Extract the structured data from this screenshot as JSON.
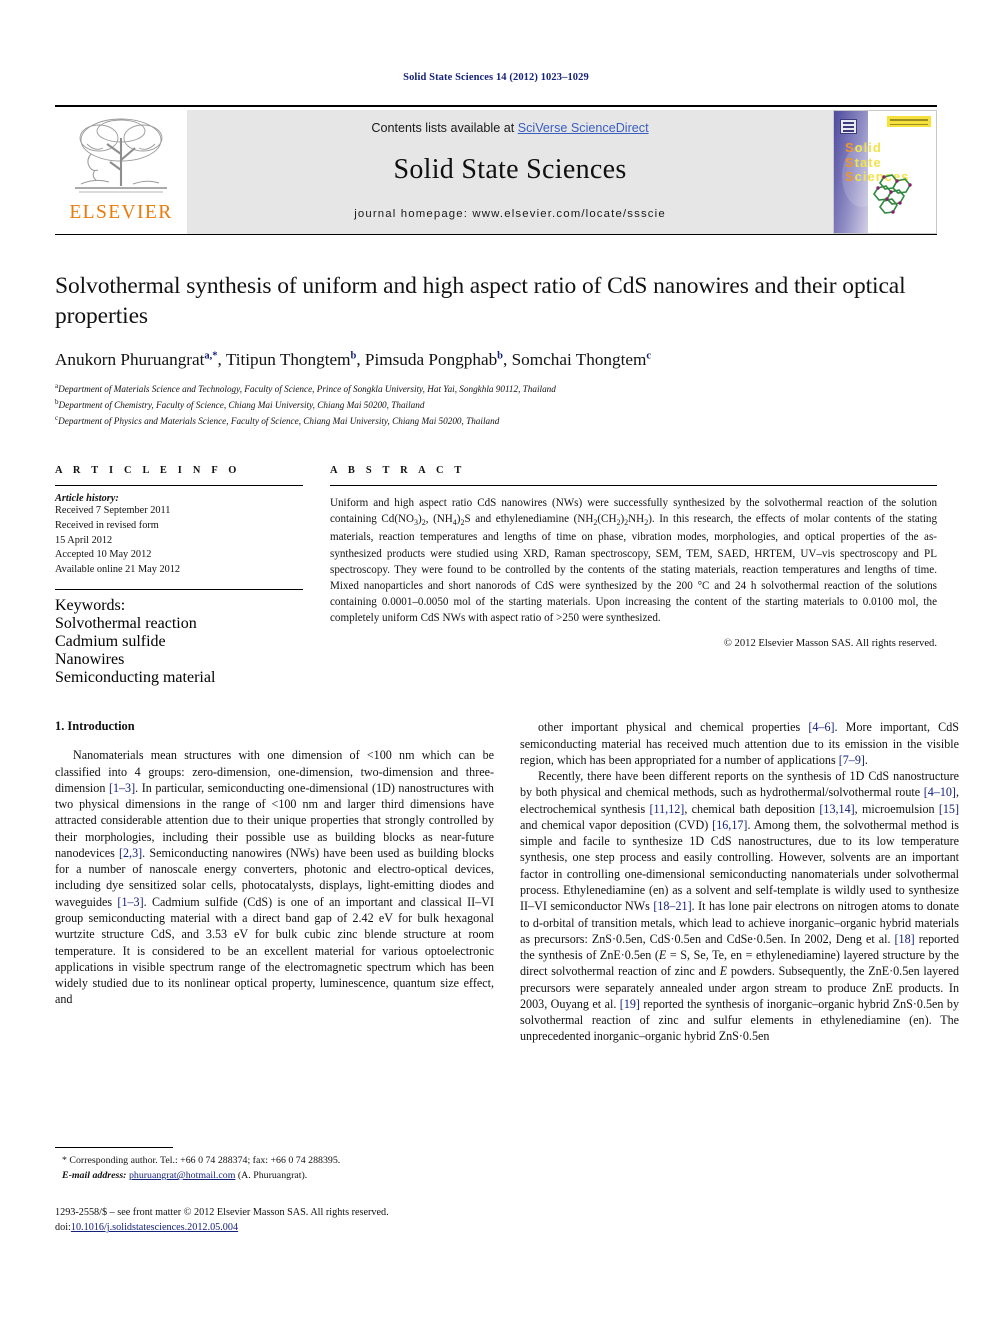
{
  "running_head": "Solid State Sciences 14 (2012) 1023–1029",
  "masthead": {
    "publisher_name": "ELSEVIER",
    "contents_prefix": "Contents lists available at ",
    "contents_link": "SciVerse ScienceDirect",
    "journal_name": "Solid State Sciences",
    "homepage": "journal homepage: www.elsevier.com/locate/ssscie",
    "cover": {
      "line1_first": "S",
      "line1_rest": "olid",
      "line2_first": "S",
      "line2_rest": "tate",
      "line3_first": "S",
      "line3_rest": "ciences"
    }
  },
  "title": "Solvothermal synthesis of uniform and high aspect ratio of CdS nanowires and their optical properties",
  "authors_html": "Anukorn Phuruangrat<sup>a,*</sup>, Titipun Thongtem<sup>b</sup>, Pimsuda Pongphab<sup>b</sup>, Somchai Thongtem<sup>c</sup>",
  "affiliations": [
    {
      "mark": "a",
      "text": "Department of Materials Science and Technology, Faculty of Science, Prince of Songkla University, Hat Yai, Songkhla 90112, Thailand"
    },
    {
      "mark": "b",
      "text": "Department of Chemistry, Faculty of Science, Chiang Mai University, Chiang Mai 50200, Thailand"
    },
    {
      "mark": "c",
      "text": "Department of Physics and Materials Science, Faculty of Science, Chiang Mai University, Chiang Mai 50200, Thailand"
    }
  ],
  "article_info": {
    "heading": "A R T I C L E   I N F O",
    "history_label": "Article history:",
    "history_lines": [
      "Received 7 September 2011",
      "Received in revised form",
      "15 April 2012",
      "Accepted 10 May 2012",
      "Available online 21 May 2012"
    ],
    "keywords_label": "Keywords:",
    "keywords": [
      "Solvothermal reaction",
      "Cadmium sulfide",
      "Nanowires",
      "Semiconducting material"
    ]
  },
  "abstract": {
    "heading": "A B S T R A C T",
    "text_html": "Uniform and high aspect ratio CdS nanowires (NWs) were successfully synthesized by the solvothermal reaction of the solution containing Cd(NO<sub>3</sub>)<sub>2</sub>, (NH<sub>4</sub>)<sub>2</sub>S and ethylenediamine (NH<sub>2</sub>(CH<sub>2</sub>)<sub>2</sub>NH<sub>2</sub>). In this research, the effects of molar contents of the stating materials, reaction temperatures and lengths of time on phase, vibration modes, morphologies, and optical properties of the as-synthesized products were studied using XRD, Raman spectroscopy, SEM, TEM, SAED, HRTEM, UV–vis spectroscopy and PL spectroscopy. They were found to be controlled by the contents of the stating materials, reaction temperatures and lengths of time. Mixed nanoparticles and short nanorods of CdS were synthesized by the 200 °C and 24 h solvothermal reaction of the solutions containing 0.0001–0.0050 mol of the starting materials. Upon increasing the content of the starting materials to 0.0100 mol, the completely uniform CdS NWs with aspect ratio of >250 were synthesized.",
    "copyright": "© 2012 Elsevier Masson SAS. All rights reserved."
  },
  "body": {
    "section_title": "1. Introduction",
    "left_paragraphs_html": [
      "Nanomaterials mean structures with one dimension of &lt;100 nm which can be classified into 4 groups: zero-dimension, one-dimension, two-dimension and three-dimension <span class=\"ref\">[1–3]</span>. In particular, semiconducting one-dimensional (1D) nanostructures with two physical dimensions in the range of &lt;100 nm and larger third dimensions have attracted considerable attention due to their unique properties that strongly controlled by their morphologies, including their possible use as building blocks as near-future nanodevices <span class=\"ref\">[2,3]</span>. Semiconducting nanowires (NWs) have been used as building blocks for a number of nanoscale energy converters, photonic and electro-optical devices, including dye sensitized solar cells, photocatalysts, displays, light-emitting diodes and waveguides <span class=\"ref\">[1–3]</span>. Cadmium sulfide (CdS) is one of an important and classical II–VI group semiconducting material with a direct band gap of 2.42 eV for bulk hexagonal wurtzite structure CdS, and 3.53 eV for bulk cubic zinc blende structure at room temperature. It is considered to be an excellent material for various optoelectronic applications in visible spectrum range of the electromagnetic spectrum which has been widely studied due to its nonlinear optical property, luminescence, quantum size effect, and"
    ],
    "right_paragraphs_html": [
      "other important physical and chemical properties <span class=\"ref\">[4–6]</span>. More important, CdS semiconducting material has received much attention due to its emission in the visible region, which has been appropriated for a number of applications <span class=\"ref\">[7–9]</span>.",
      "Recently, there have been different reports on the synthesis of 1D CdS nanostructure by both physical and chemical methods, such as hydrothermal/solvothermal route <span class=\"ref\">[4–10]</span>, electrochemical synthesis <span class=\"ref\">[11,12]</span>, chemical bath deposition <span class=\"ref\">[13,14]</span>, microemulsion <span class=\"ref\">[15]</span> and chemical vapor deposition (CVD) <span class=\"ref\">[16,17]</span>. Among them, the solvothermal method is simple and facile to synthesize 1D CdS nanostructures, due to its low temperature synthesis, one step process and easily controlling. However, solvents are an important factor in controlling one-dimensional semiconducting nanomaterials under solvothermal process. Ethylenediamine (en) as a solvent and self-template is wildly used to synthesize II–VI semiconductor NWs <span class=\"ref\">[18–21]</span>. It has lone pair electrons on nitrogen atoms to donate to d-orbital of transition metals, which lead to achieve inorganic–organic hybrid materials as precursors: ZnS·0.5en, CdS·0.5en and CdSe·0.5en. In 2002, Deng et al. <span class=\"ref\">[18]</span> reported the synthesis of ZnE·0.5en (<span class=\"em\">E</span> = S, Se, Te, en = ethylenediamine) layered structure by the direct solvothermal reaction of zinc and <span class=\"em\">E</span> powders. Subsequently, the ZnE·0.5en layered precursors were separately annealed under argon stream to produce ZnE products. In 2003, Ouyang et al. <span class=\"ref\">[19]</span> reported the synthesis of inorganic–organic hybrid ZnS·0.5en by solvothermal reaction of zinc and sulfur elements in ethylenediamine (en). The unprecedented inorganic–organic hybrid ZnS·0.5en"
    ]
  },
  "footnote": {
    "star": "*",
    "line1": "Corresponding author. Tel.: +66 0 74 288374; fax: +66 0 74 288395.",
    "email_label": "E-mail address:",
    "email": "phuruangrat@hotmail.com",
    "email_suffix": "(A. Phuruangrat)."
  },
  "page_footer": {
    "line1": "1293-2558/$ – see front matter © 2012 Elsevier Masson SAS. All rights reserved.",
    "doi_label": "doi:",
    "doi_value": "10.1016/j.solidstatesciences.2012.05.004"
  }
}
